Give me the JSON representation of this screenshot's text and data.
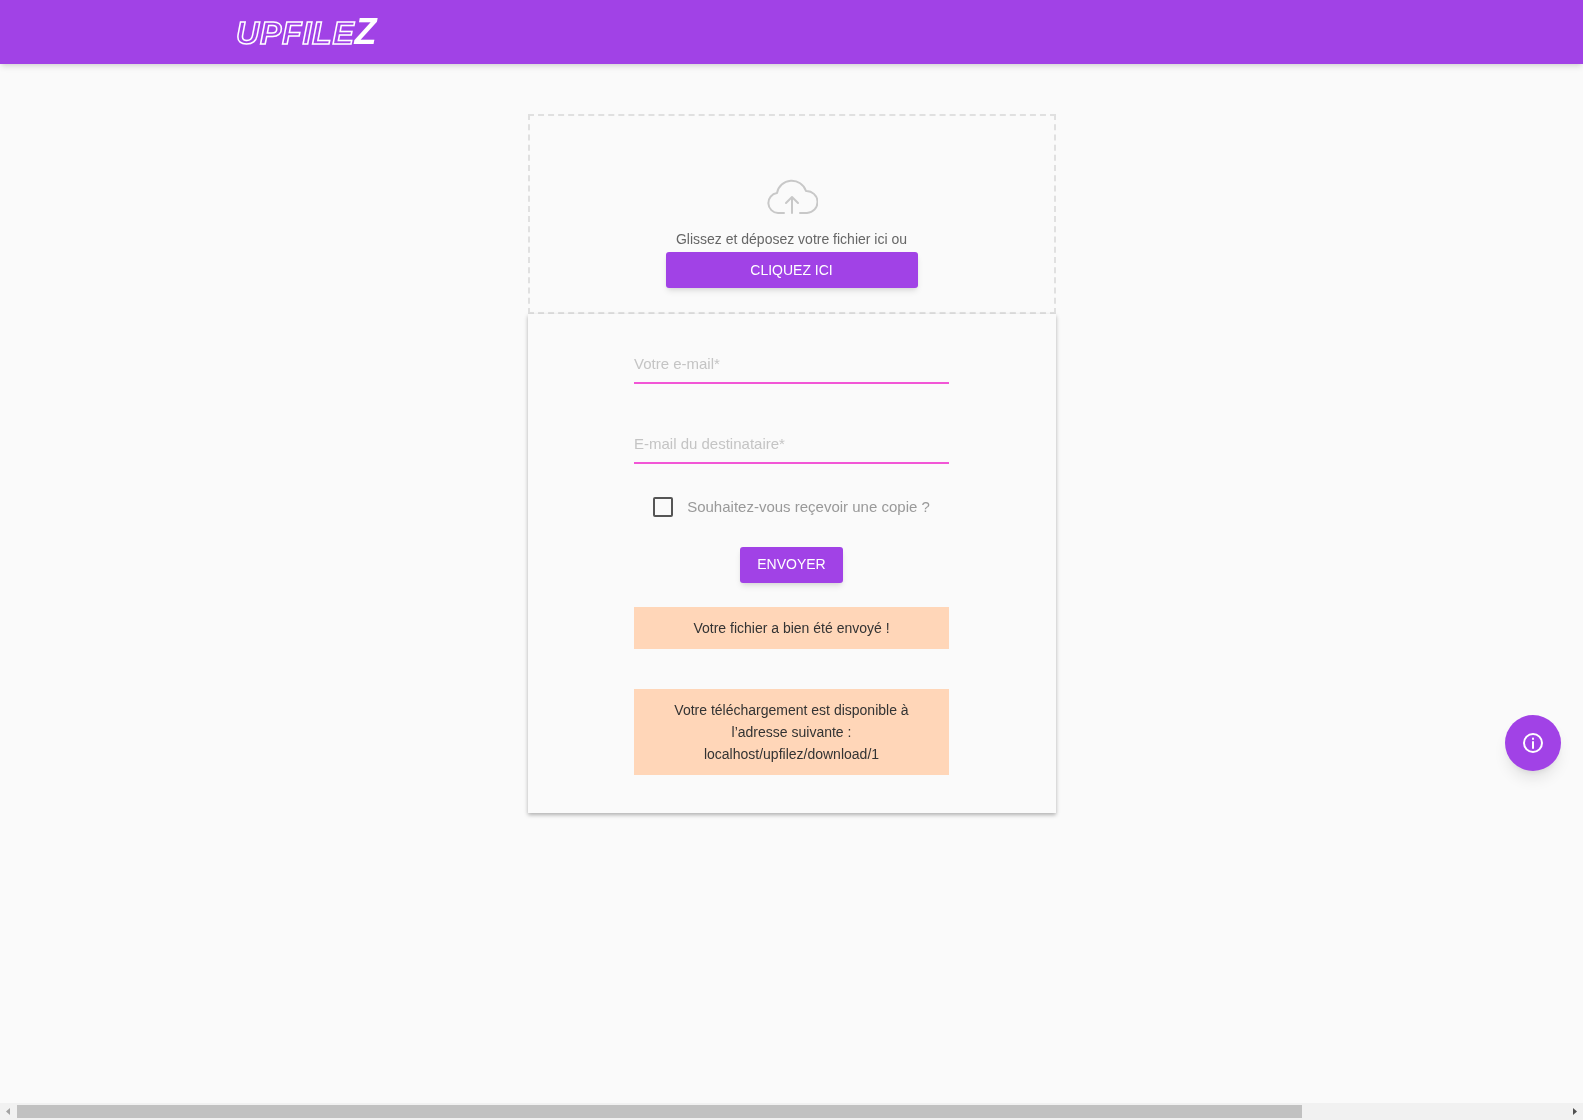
{
  "header": {
    "logo": {
      "main": "UPFILE",
      "accent": "Z"
    }
  },
  "dropzone": {
    "prompt": "Glissez et déposez votre fichier ici ou",
    "button": "CLIQUEZ ICI"
  },
  "form": {
    "fields": [
      {
        "placeholder": "Votre e-mail*"
      },
      {
        "placeholder": "E-mail du destinataire*"
      }
    ],
    "copy_checkbox": {
      "label": "Souhaitez-vous reçevoir une copie ?",
      "checked": false
    },
    "submit": "ENVOYER",
    "messages": [
      "Votre fichier a bien été envoyé !",
      "Votre téléchargement est disponible à l’adresse suivante : localhost/upfilez/download/1"
    ]
  }
}
